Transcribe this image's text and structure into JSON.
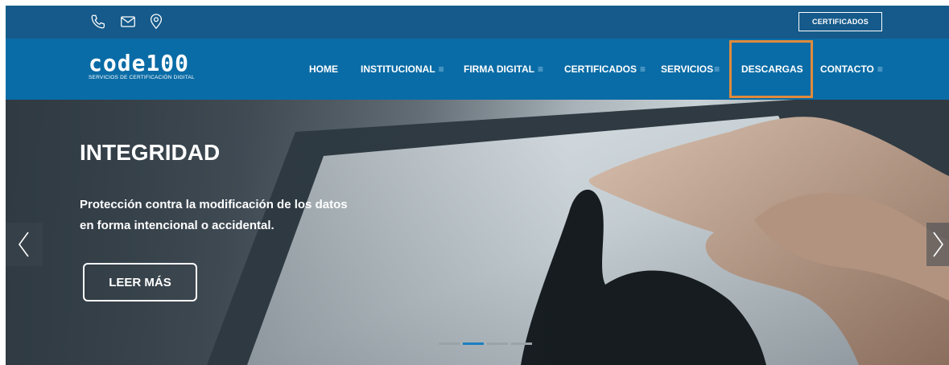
{
  "topbar": {
    "icons": [
      "phone-icon",
      "mail-icon",
      "location-icon"
    ],
    "certificados_button": "CERTIFICADOS"
  },
  "logo": {
    "wordmark": "code100",
    "tagline": "SERVICIOS DE CERTIFICACIÓN DIGITAL"
  },
  "nav": {
    "items": [
      {
        "label": "HOME",
        "has_menu": false
      },
      {
        "label": "INSTITUCIONAL",
        "has_menu": true
      },
      {
        "label": "FIRMA DIGITAL",
        "has_menu": true
      },
      {
        "label": "CERTIFICADOS",
        "has_menu": true
      },
      {
        "label": "SERVICIOS",
        "has_menu": true
      },
      {
        "label": "DESCARGAS",
        "has_menu": false,
        "highlighted": true
      },
      {
        "label": "CONTACTO",
        "has_menu": true
      }
    ],
    "menu_glyph": "≡"
  },
  "hero": {
    "title": "INTEGRIDAD",
    "line1": "Protección contra la modificación de los datos",
    "line2": "en forma intencional o accidental.",
    "button": "LEER MÁS",
    "prev_arrow": "chevron-left-icon",
    "next_arrow": "chevron-right-icon",
    "slide_count": 4,
    "active_slide": 2
  },
  "colors": {
    "topbar": "#155a8a",
    "navbar": "#0a6ca6",
    "highlight": "#e08a3a",
    "active_dot": "#1b7fc1"
  }
}
